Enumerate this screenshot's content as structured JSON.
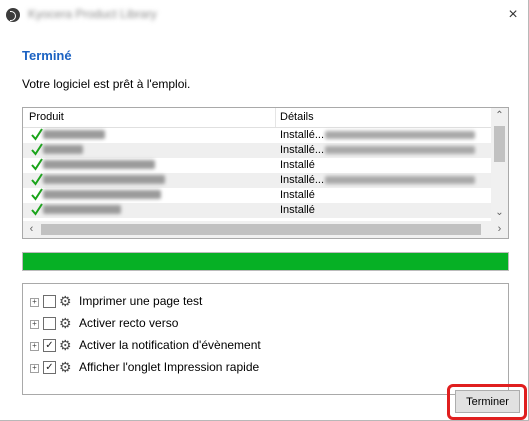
{
  "window": {
    "title": "Kyocera Product Library",
    "close_glyph": "×"
  },
  "heading": "Terminé",
  "subtitle": "Votre logiciel est prêt à l'emploi.",
  "table": {
    "columns": [
      "Produit",
      "Détails"
    ],
    "rows": [
      {
        "status": "Installé..."
      },
      {
        "status": "Installé..."
      },
      {
        "status": "Installé"
      },
      {
        "status": "Installé..."
      },
      {
        "status": "Installé"
      },
      {
        "status": "Installé"
      }
    ]
  },
  "progress": {
    "value": 1.0,
    "color": "#06b025"
  },
  "options": [
    {
      "label": "Imprimer une page test",
      "checked": false
    },
    {
      "label": "Activer recto verso",
      "checked": false
    },
    {
      "label": "Activer la notification d'évènement",
      "checked": true
    },
    {
      "label": "Afficher l'onglet Impression rapide",
      "checked": true
    }
  ],
  "finish_button": {
    "label": "Terminer",
    "highlight_color": "#e01f1f"
  },
  "colors": {
    "heading": "#1b62c2",
    "check": "#1aa41a"
  },
  "icons": [
    "app-icon",
    "close-icon",
    "check-icon",
    "gear-icon",
    "expand-icon"
  ]
}
